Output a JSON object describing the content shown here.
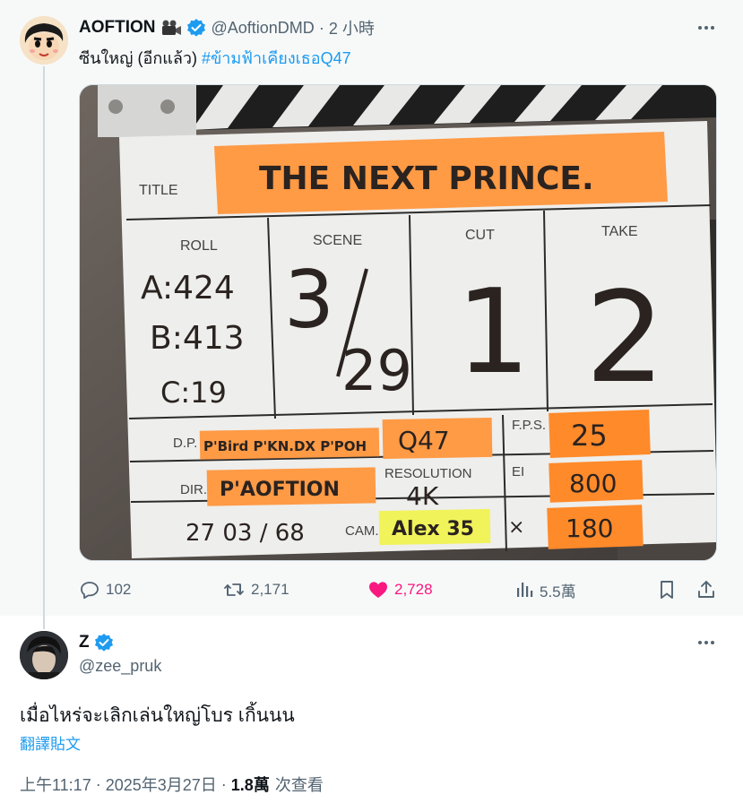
{
  "parent_tweet": {
    "author_name": "AOFTION",
    "author_emoji": "movie-camera-icon",
    "handle": "@AoftionDMD",
    "separator": "·",
    "time_ago": "2 小時",
    "text_plain": "ซีนใหญ่ (อีกแล้ว) ",
    "hashtag": "#ข้ามฟ้าเคียงเธอQ47",
    "image": {
      "title_label": "TITLE",
      "title": "THE NEXT PRINCE.",
      "roll_label": "ROLL",
      "roll_a": "A:424",
      "roll_b": "B:413",
      "roll_c": "C:19",
      "scene_label": "SCENE",
      "scene_num": "3",
      "scene_den": "29",
      "cut_label": "CUT",
      "cut": "1",
      "take_label": "TAKE",
      "take": "2",
      "dp_label": "D.P.",
      "dp": "P'Bird P'KN.DX P'POH",
      "unit": "Q47",
      "fps_label": "F.P.S.",
      "fps": "25",
      "dir_label": "DIR.",
      "dir": "P'AOFTION",
      "resolution_label": "RESOLUTION",
      "resolution": "4K",
      "ei_label": "EI",
      "ei": "800",
      "date": "27 03 / 68",
      "cam_label": "CAM.",
      "cam": "Alex 35",
      "shutter_symbol": "⨯",
      "shutter": "180",
      "colors": {
        "tape_orange": "#ff9a45",
        "tape_yellow": "#f1f35a",
        "board": "#eeeeec"
      }
    },
    "stats": {
      "replies": "102",
      "retweets": "2,171",
      "likes": "2,728",
      "views": "5.5萬"
    }
  },
  "main_tweet": {
    "author_name": "Z",
    "handle": "@zee_pruk",
    "text": "เมื่อไหร่จะเลิกเล่นใหญ่โบร เกิ้นนน",
    "translate_label": "翻譯貼文",
    "time": "上午11:17",
    "separator": "·",
    "date": "2025年3月27日",
    "views_count": "1.8萬",
    "views_label": "次查看"
  },
  "colors": {
    "accent": "#1d9bf0",
    "like": "#f91880",
    "muted": "#536471",
    "text": "#0f1419"
  }
}
